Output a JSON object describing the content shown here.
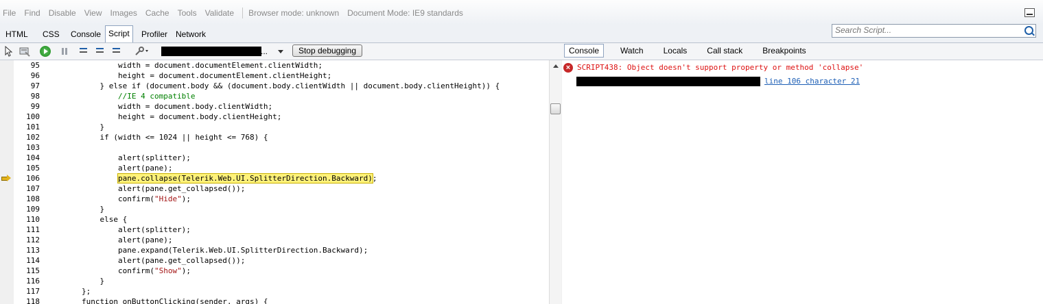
{
  "menu": {
    "items": [
      "File",
      "Find",
      "Disable",
      "View",
      "Images",
      "Cache",
      "Tools",
      "Validate"
    ],
    "browser_mode": "Browser mode: unknown",
    "document_mode": "Document Mode: IE9 standards"
  },
  "tabs": [
    "HTML",
    "CSS",
    "Console",
    "Script",
    "Profiler",
    "Network"
  ],
  "active_tab": "Script",
  "search": {
    "placeholder": "Search Script..."
  },
  "toolbar": {
    "target_suffix": "... ",
    "stop_label": "Stop debugging"
  },
  "panel_tabs": [
    "Console",
    "Watch",
    "Locals",
    "Call stack",
    "Breakpoints"
  ],
  "active_panel_tab": "Console",
  "code_lines": [
    {
      "n": "95",
      "indent": "                ",
      "text": "width = document.documentElement.clientWidth;"
    },
    {
      "n": "96",
      "indent": "                ",
      "text": "height = document.documentElement.clientHeight;"
    },
    {
      "n": "97",
      "indent": "            ",
      "text": "} else if (document.body && (document.body.clientWidth || document.body.clientHeight)) {"
    },
    {
      "n": "98",
      "indent": "                ",
      "text": "//IE 4 compatible",
      "kind": "comment"
    },
    {
      "n": "99",
      "indent": "                ",
      "text": "width = document.body.clientWidth;"
    },
    {
      "n": "100",
      "indent": "                ",
      "text": "height = document.body.clientHeight;"
    },
    {
      "n": "101",
      "indent": "            ",
      "text": "}"
    },
    {
      "n": "102",
      "indent": "            ",
      "text": "if (width <= 1024 || height <= 768) {"
    },
    {
      "n": "103",
      "indent": "",
      "text": ""
    },
    {
      "n": "104",
      "indent": "                ",
      "text": "alert(splitter);"
    },
    {
      "n": "105",
      "indent": "                ",
      "text": "alert(pane);"
    },
    {
      "n": "106",
      "indent": "                ",
      "text": "pane.collapse(Telerik.Web.UI.SplitterDirection.Backward)",
      "tail": ";",
      "kind": "current"
    },
    {
      "n": "107",
      "indent": "                ",
      "text": "alert(pane.get_collapsed());"
    },
    {
      "n": "108",
      "indent": "                ",
      "pre": "confirm(",
      "str": "\"Hide\"",
      "post": ");",
      "kind": "string"
    },
    {
      "n": "109",
      "indent": "            ",
      "text": "}"
    },
    {
      "n": "110",
      "indent": "            ",
      "text": "else {"
    },
    {
      "n": "111",
      "indent": "                ",
      "text": "alert(splitter);"
    },
    {
      "n": "112",
      "indent": "                ",
      "text": "alert(pane);"
    },
    {
      "n": "113",
      "indent": "                ",
      "text": "pane.expand(Telerik.Web.UI.SplitterDirection.Backward);"
    },
    {
      "n": "114",
      "indent": "                ",
      "text": "alert(pane.get_collapsed());"
    },
    {
      "n": "115",
      "indent": "                ",
      "pre": "confirm(",
      "str": "\"Show\"",
      "post": ");",
      "kind": "string"
    },
    {
      "n": "116",
      "indent": "            ",
      "text": "}"
    },
    {
      "n": "117",
      "indent": "        ",
      "text": "};"
    },
    {
      "n": "118",
      "indent": "        ",
      "text": "function onButtonClicking(sender, args) {"
    }
  ],
  "console": {
    "error_message": "SCRIPT438: Object doesn't support property or method 'collapse'",
    "error_location": "line 106 character 21"
  }
}
